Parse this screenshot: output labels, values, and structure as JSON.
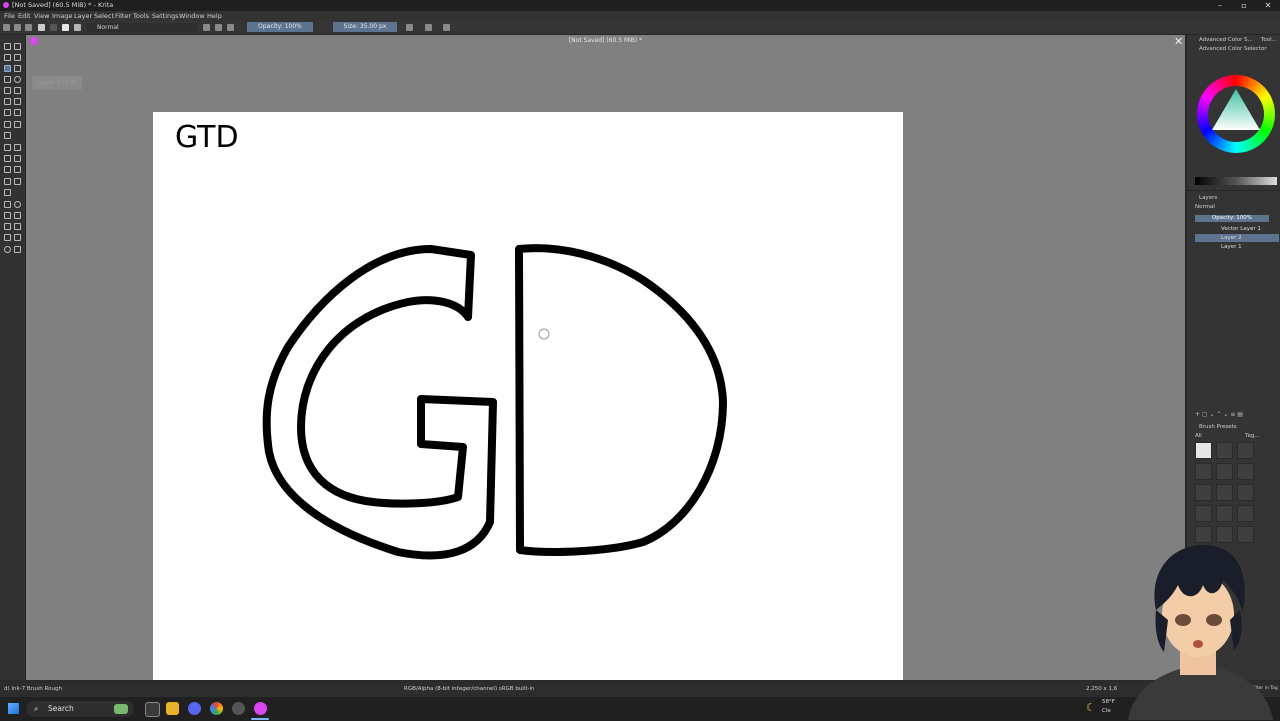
{
  "window": {
    "title": "[Not Saved]  (60.5 MiB) * - Krita"
  },
  "menu": [
    "File",
    "Edit",
    "View",
    "Image",
    "Layer",
    "Select",
    "Filter",
    "Tools",
    "Settings",
    "Window",
    "Help"
  ],
  "toolbar": {
    "blend_mode": "Normal",
    "opacity": "Opacity: 100%",
    "size": "Size: 35.00 px"
  },
  "canvas": {
    "doc_title": "[Not Saved]  (60.5 MiB) *",
    "ghost_label": "Layer 2 (1.0)",
    "text_on_canvas": "GTD"
  },
  "docker": {
    "tabs": [
      "Advanced Color S...",
      "Tool..."
    ],
    "color_selector_title": "Advanced Color Selector",
    "layers_title": "Layers",
    "layer_blend": "Normal",
    "layer_opacity": "Opacity: 100%",
    "layers": [
      "Vector Layer 1",
      "Layer 2",
      "Layer 1"
    ],
    "selected_layer_index": 1,
    "brush_presets_title": "Brush Presets",
    "brush_filter": "All",
    "brush_tag": "Tag..."
  },
  "status": {
    "brush": "d) Ink-7 Brush Rough",
    "color_info": "RGB/Alpha (8-bit integer/channel)  sRGB built-in",
    "dims": "2,250 x 1,6",
    "filter_tag": "Filter in Tag"
  },
  "taskbar": {
    "search": "Search",
    "weather_temp": "58°F",
    "weather_desc": "Cle"
  },
  "colors": {
    "accent": "#5d7390",
    "canvas_bg": "#808080",
    "paper": "#ffffff"
  }
}
